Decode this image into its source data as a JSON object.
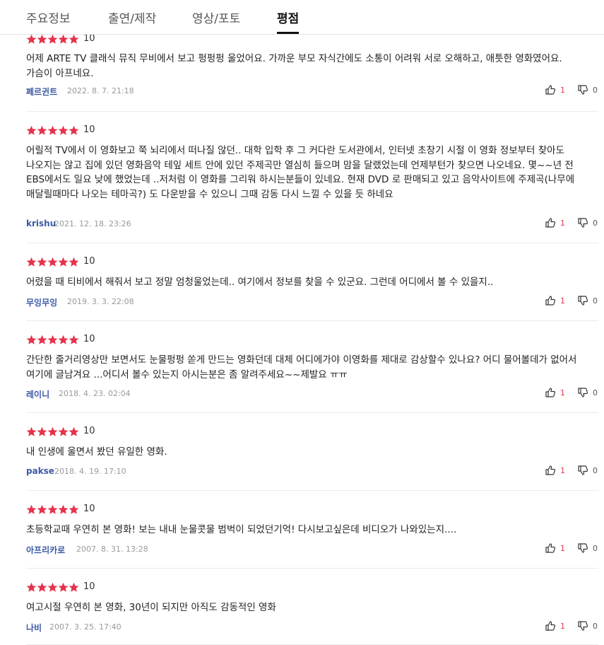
{
  "tabs": [
    {
      "label": "주요정보",
      "active": false
    },
    {
      "label": "출연/제작",
      "active": false
    },
    {
      "label": "영상/포토",
      "active": false
    },
    {
      "label": "평점",
      "active": true
    }
  ],
  "colors": {
    "star": "#e6324b",
    "author": "#3b5aa3",
    "like_count": "#e6324b"
  },
  "reviews": [
    {
      "rating": "10",
      "content": "어제 ARTE TV 클래식 뮤직 무비에서 보고 펑펑펑 울었어요. 가까운 부모 자식간에도 소통이 어려워 서로 오해하고, 애틋한 영화였어요. 가슴이 아프네요.",
      "author": "페르귄트",
      "date": "2022. 8. 7. 21:18",
      "likes": "1",
      "dislikes": "0"
    },
    {
      "rating": "10",
      "content": "어릴적 TV에서 이 영화보고 쭉 뇌리에서 떠나질 않던.. 대학 입학 후 그 커다란 도서관에서, 인터넷 초창기 시절 이 영화 정보부터 찾아도 나오지는 않고 집에 있던 영화음악 테잎 세트 안에 있던 주제곡만 열심히 들으며 맘을 달랬었는데 언제부턴가 찾으면 나오네요. 몇~~년 전 EBS에서도 일요 낮에 했었는데 ..저처럼 이 영화를 그리워 하시는분들이 있네요. 현재 DVD 로 판매되고 있고 음악사이트에 주제곡(나무에 매달릴때마다 나오는 테마곡?) 도 다운받을 수 있으니 그때 감동 다시 느낄 수 있을 듯 하네요",
      "author": "krishu",
      "date": "2021. 12. 18. 23:26",
      "likes": "1",
      "dislikes": "0"
    },
    {
      "rating": "10",
      "content": "어렸을 때 티비에서 해줘서 보고 정말 엄청울었는데.. 여기에서 정보를 찾을 수 있군요. 그런데 어디에서 볼 수 있을지..",
      "author": "무잉무잉",
      "date": "2019. 3. 3. 22:08",
      "likes": "1",
      "dislikes": "0"
    },
    {
      "rating": "10",
      "content": "간단한 줄거리영상만 보면서도 눈물펑펑 쏟게 만드는 영화던데 대체 어디에가야 이영화를 제대로 감상할수 있나요? 어디 물어볼데가 없어서 여기에 글남겨요 ...어디서 볼수 있는지 아시는분은 좀 알려주세요~~제발요 ㅠㅠ",
      "author": "레이니",
      "date": "2018. 4. 23. 02:04",
      "likes": "1",
      "dislikes": "0"
    },
    {
      "rating": "10",
      "content": "내 인생에 울면서 봤던 유일한 영화.",
      "author": "pakse",
      "date": "2018. 4. 19. 17:10",
      "likes": "1",
      "dislikes": "0"
    },
    {
      "rating": "10",
      "content": "초등학교때 우연히 본 영화! 보는 내내 눈물콧물 범벅이 되었던기억! 다시보고싶은데 비디오가 나와있는지....",
      "author": "아프리카로",
      "date": "2007. 8. 31. 13:28",
      "likes": "1",
      "dislikes": "0"
    },
    {
      "rating": "10",
      "content": "여고시절 우연히 본 영화, 30년이 되지만 아직도 감동적인 영화",
      "author": "나비",
      "date": "2007. 3. 25. 17:40",
      "likes": "1",
      "dislikes": "0"
    }
  ]
}
